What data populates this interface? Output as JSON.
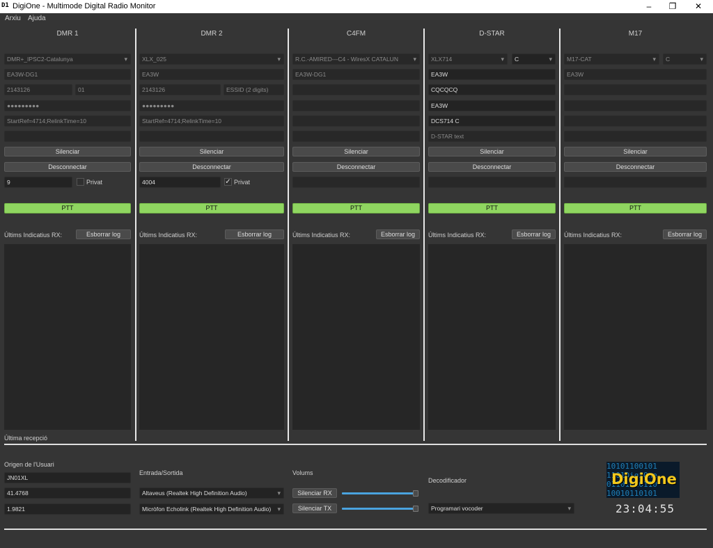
{
  "window": {
    "logo_text": "D1",
    "title": "DigiOne - Multimode Digital Radio Monitor",
    "minimize": "–",
    "maximize": "❐",
    "close": "✕"
  },
  "menu": {
    "file": "Arxiu",
    "help": "Ajuda"
  },
  "columns": [
    {
      "title": "DMR 1",
      "reflector": "DMR+_IPSC2-Catalunya",
      "callsign": "EA3W-DG1",
      "id": "2143126",
      "essid": "01",
      "password": "●●●●●●●●●",
      "options": "StartRef=4714;RelinkTime=10",
      "mute": "Silenciar",
      "disconnect": "Desconnectar",
      "tg": "9",
      "private_label": "Privat",
      "private_checked": "",
      "ptt": "PTT",
      "last_rx_label": "Últims Indicatius RX:",
      "clear_log": "Esborrar log"
    },
    {
      "title": "DMR 2",
      "reflector": "XLX_025",
      "callsign": "EA3W",
      "id": "2143126",
      "essid": "ESSID (2 digits)",
      "password": "●●●●●●●●●",
      "options": "StartRef=4714;RelinkTime=10",
      "mute": "Silenciar",
      "disconnect": "Desconnectar",
      "tg": "4004",
      "private_label": "Privat",
      "private_checked": "✓",
      "ptt": "PTT",
      "last_rx_label": "Últims Indicatius RX:",
      "clear_log": "Esborrar log"
    },
    {
      "title": "C4FM",
      "reflector": "R.C.-AMIRED---C4 - WiresX CATALUN",
      "callsign": "EA3W-DG1",
      "mute": "Silenciar",
      "disconnect": "Desconnectar",
      "ptt": "PTT",
      "last_rx_label": "Últims Indicatius RX:",
      "clear_log": "Esborrar log"
    },
    {
      "title": "D-STAR",
      "reflector": "XLX714",
      "module": "C",
      "mycall": "EA3W",
      "urcall": "CQCQCQ",
      "rpt1": "EA3W",
      "rpt2": "DCS714 C",
      "text_placeholder": "D-STAR text",
      "mute": "Silenciar",
      "disconnect": "Desconnectar",
      "ptt": "PTT",
      "last_rx_label": "Últims Indicatius RX:",
      "clear_log": "Esborrar log"
    },
    {
      "title": "M17",
      "reflector": "M17-CAT",
      "module": "C",
      "callsign": "EA3W",
      "mute": "Silenciar",
      "disconnect": "Desconnectar",
      "ptt": "PTT",
      "last_rx_label": "Últims Indicatius RX:",
      "clear_log": "Esborrar log"
    }
  ],
  "status": {
    "last_reception": "Última recepció"
  },
  "bottom": {
    "user_origin_label": "Origen de l'Usuari",
    "locator": "JN01XL",
    "latitude": "41.4768",
    "longitude": "1.9821",
    "io_label": "Entrada/Sortida",
    "output_device": "Altaveus (Realtek High Definition Audio)",
    "input_device": "Micròfon Echolink (Realtek High Definition Audio)",
    "volumes_label": "Volums",
    "mute_rx": "Silenciar RX",
    "mute_tx": "Silenciar TX",
    "rx_volume_level": 1.0,
    "tx_volume_level": 1.0,
    "decoder_label": "Decodificador",
    "decoder_value": "Programari vocoder",
    "logo_word": "DigiOne",
    "logo_bits": "10101100101\n1101DigiOne\n01101010110\n10010110101",
    "clock": "23:04:55"
  }
}
